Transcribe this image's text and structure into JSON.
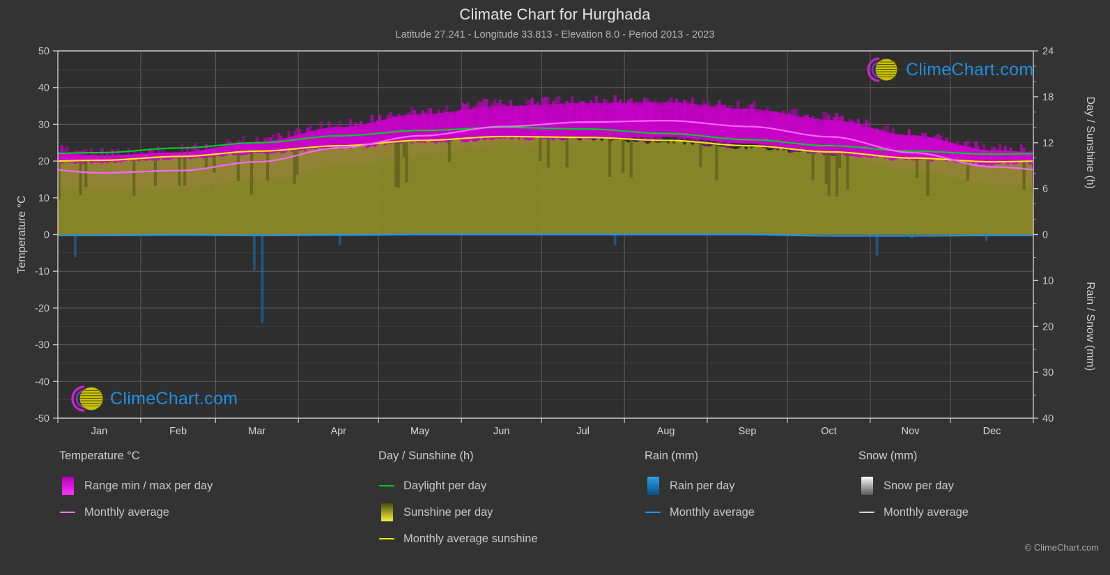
{
  "header": {
    "title": "Climate Chart for Hurghada",
    "subtitle": "Latitude 27.241 - Longitude 33.813 - Elevation 8.0 - Period 2013 - 2023"
  },
  "branding": {
    "wordmark": "ClimeChart.com",
    "copyright": "© ClimeChart.com",
    "logo_arc_color": "#cc22cc",
    "logo_sphere_color": "#d8d000",
    "wordmark_color": "#1f8fe0"
  },
  "colors": {
    "background": "#333333",
    "plot_background": "#2e2e2e",
    "grid": "#7a7a7a",
    "axis": "#cccccc",
    "temp_range": "#cc00cc",
    "temp_avg": "#ff66ff",
    "daylight": "#00cc22",
    "sunshine_fill": "#8c8c28",
    "sunshine_avg": "#eeee00",
    "rain": "#1f8fe0",
    "rain_avg": "#2196f3",
    "snow": "#e8e8e8"
  },
  "axes": {
    "left": {
      "title": "Temperature °C",
      "ticks": [
        50,
        40,
        30,
        20,
        10,
        0,
        -10,
        -20,
        -30,
        -40,
        -50
      ],
      "min": -50,
      "max": 50
    },
    "right_top": {
      "title": "Day / Sunshine (h)",
      "ticks": [
        24,
        18,
        12,
        6,
        0
      ],
      "min": 0,
      "max": 24
    },
    "right_bottom": {
      "title": "Rain / Snow (mm)",
      "ticks": [
        0,
        10,
        20,
        30,
        40
      ],
      "min": 0,
      "max": 40
    },
    "x": {
      "labels": [
        "Jan",
        "Feb",
        "Mar",
        "Apr",
        "May",
        "Jun",
        "Jul",
        "Aug",
        "Sep",
        "Oct",
        "Nov",
        "Dec"
      ]
    }
  },
  "legend": {
    "groups": [
      {
        "title": "Temperature °C",
        "items": [
          {
            "label": "Range min / max per day",
            "key": "gradient-box",
            "color": "#cc00cc"
          },
          {
            "label": "Monthly average",
            "key": "line",
            "color": "#e87fe8"
          }
        ]
      },
      {
        "title": "Day / Sunshine (h)",
        "items": [
          {
            "label": "Daylight per day",
            "key": "line",
            "color": "#00cc22"
          },
          {
            "label": "Sunshine per day",
            "key": "gradient-box",
            "color": "#eeee22"
          },
          {
            "label": "Monthly average sunshine",
            "key": "line",
            "color": "#eeee00"
          }
        ]
      },
      {
        "title": "Rain (mm)",
        "items": [
          {
            "label": "Rain per day",
            "key": "gradient-box",
            "color": "#1f8fe0"
          },
          {
            "label": "Monthly average",
            "key": "line",
            "color": "#2196f3"
          }
        ]
      },
      {
        "title": "Snow (mm)",
        "items": [
          {
            "label": "Snow per day",
            "key": "gradient-box",
            "color": "#e8e8e8"
          },
          {
            "label": "Monthly average",
            "key": "line",
            "color": "#d8d8d8"
          }
        ]
      }
    ]
  },
  "chart_data": {
    "type": "area",
    "title": "Climate Chart for Hurghada",
    "subtitle": "Latitude 27.241 - Longitude 33.813 - Elevation 8.0 - Period 2013 - 2023",
    "xlabel": "",
    "ylabel": "Temperature °C",
    "y2label_top": "Day / Sunshine (h)",
    "y2label_bottom": "Rain / Snow (mm)",
    "ylim": [
      -50,
      50
    ],
    "y2lim_sun": [
      0,
      24
    ],
    "y2lim_rain": [
      0,
      40
    ],
    "grid": true,
    "legend_position": "below",
    "categories": [
      "Jan",
      "Feb",
      "Mar",
      "Apr",
      "May",
      "Jun",
      "Jul",
      "Aug",
      "Sep",
      "Oct",
      "Nov",
      "Dec"
    ],
    "series": [
      {
        "name": "Monthly average temperature (°C)",
        "unit": "°C",
        "color": "#ff66ff",
        "values": [
          16.8,
          17.4,
          19.8,
          23.6,
          26.9,
          29.4,
          30.6,
          31.0,
          29.4,
          26.6,
          22.3,
          18.4
        ]
      },
      {
        "name": "Daily max temperature (°C)",
        "unit": "°C",
        "color": "#cc00cc",
        "values": [
          21.5,
          22.4,
          25.2,
          29.3,
          32.8,
          35.0,
          35.8,
          36.0,
          34.2,
          31.2,
          27.0,
          22.9
        ]
      },
      {
        "name": "Daily min temperature (°C)",
        "unit": "°C",
        "color": "#cc00cc",
        "values": [
          12.4,
          12.9,
          15.2,
          18.9,
          22.1,
          24.6,
          26.1,
          26.6,
          24.8,
          21.8,
          17.8,
          14.0
        ]
      },
      {
        "name": "Daylight per day (h)",
        "unit": "h",
        "color": "#00cc22",
        "values": [
          10.7,
          11.3,
          12.0,
          12.9,
          13.6,
          14.0,
          13.8,
          13.2,
          12.4,
          11.6,
          10.9,
          10.5
        ]
      },
      {
        "name": "Monthly average sunshine (h)",
        "unit": "h",
        "color": "#eeee00",
        "values": [
          9.7,
          10.2,
          10.9,
          11.6,
          12.3,
          12.8,
          12.7,
          12.3,
          11.6,
          10.8,
          10.0,
          9.5
        ]
      },
      {
        "name": "Monthly average rain (mm)",
        "unit": "mm",
        "color": "#2196f3",
        "values": [
          0.2,
          0.1,
          0.2,
          0.1,
          0.0,
          0.0,
          0.0,
          0.0,
          0.0,
          0.3,
          0.3,
          0.2
        ]
      },
      {
        "name": "Monthly average snow (mm)",
        "unit": "mm",
        "color": "#e8e8e8",
        "values": [
          0,
          0,
          0,
          0,
          0,
          0,
          0,
          0,
          0,
          0,
          0,
          0
        ]
      }
    ]
  }
}
